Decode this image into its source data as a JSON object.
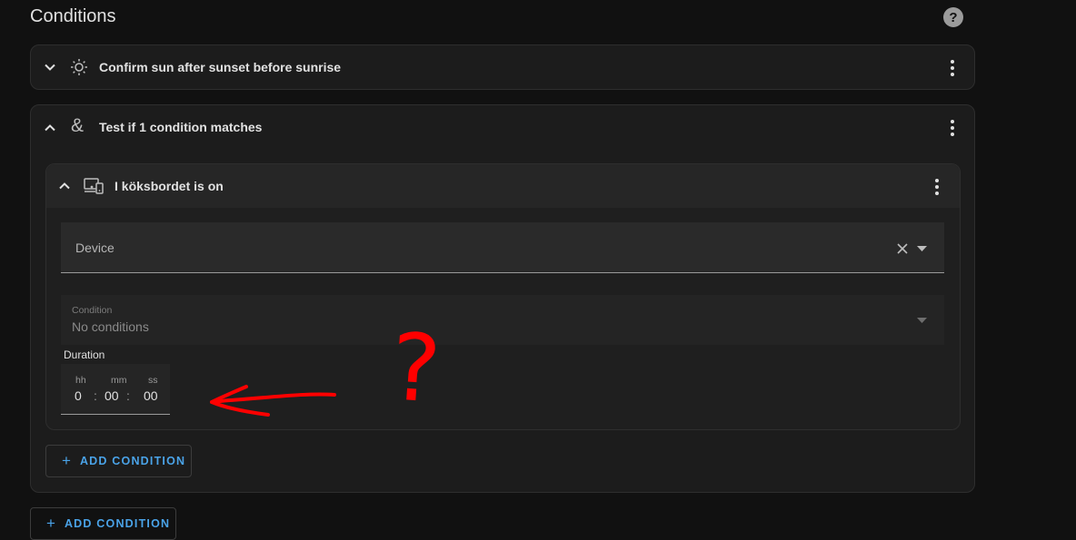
{
  "header": {
    "title": "Conditions",
    "help_glyph": "?"
  },
  "conditions": [
    {
      "title": "Confirm sun after sunset before sunrise",
      "icon": "sun-icon",
      "expanded": false
    },
    {
      "title": "Test if 1 condition matches",
      "icon": "ampersand-icon",
      "glyph": "&",
      "expanded": true
    }
  ],
  "nested": {
    "title": "I köksbordet is on",
    "icon": "device-icon",
    "device_field": {
      "label": "Device"
    },
    "condition_field": {
      "label": "Condition",
      "value": "No conditions"
    },
    "duration": {
      "label": "Duration",
      "hh_label": "hh",
      "mm_label": "mm",
      "ss_label": "ss",
      "hh": "0",
      "mm": "00",
      "ss": "00",
      "separator": ":"
    }
  },
  "buttons": {
    "add_condition_inner": "ADD CONDITION",
    "add_condition_outer": "ADD CONDITION",
    "plus": "+"
  },
  "annotation": {
    "question_glyph": "?"
  },
  "colors": {
    "accent": "#4aa3e8",
    "annotation": "#ff0000",
    "background": "#111111"
  }
}
